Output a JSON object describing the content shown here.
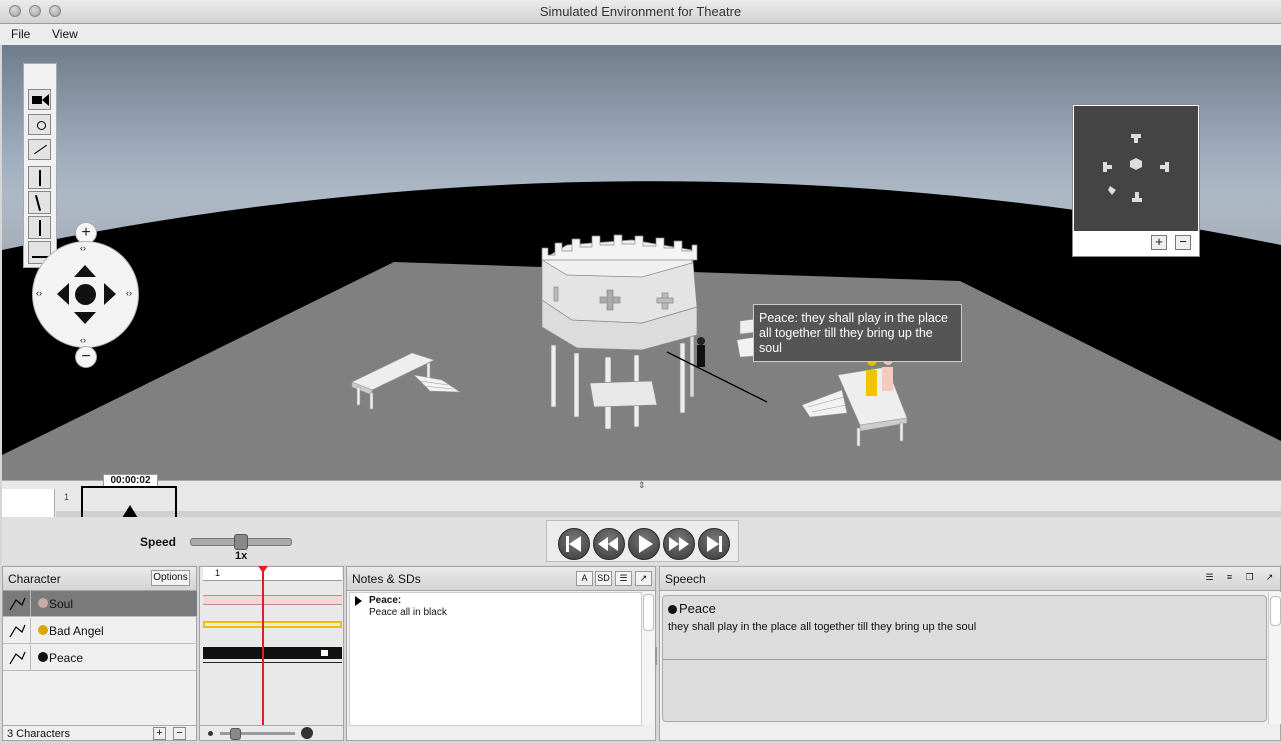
{
  "window": {
    "title": "Simulated Environment for Theatre"
  },
  "menu": {
    "file": "File",
    "view": "View"
  },
  "viewport": {
    "tooltip": {
      "speaker": "Peace",
      "text": "Peace: they shall play in the place all together till they bring up the soul"
    }
  },
  "minimap": {
    "zoom_in": "+",
    "zoom_out": "−"
  },
  "navigation": {
    "zoom_in": "+",
    "zoom_out": "−"
  },
  "timeline": {
    "time": "00:00:02",
    "marker": "1",
    "playhead_position": 0.04
  },
  "transport": {
    "speed_label": "Speed",
    "speed_value": "1x",
    "buttons": [
      "skip-back-icon",
      "rewind-icon",
      "play-icon",
      "fast-forward-icon",
      "skip-forward-icon"
    ]
  },
  "characters": {
    "title": "Character",
    "options_label": "Options",
    "count_label": "3 Characters",
    "add": "+",
    "remove": "−",
    "items": [
      {
        "name": "Soul",
        "color": "#c8a8a8",
        "selected": true
      },
      {
        "name": "Bad Angel",
        "color": "#d8a800",
        "selected": false
      },
      {
        "name": "Peace",
        "color": "#111111",
        "selected": false
      }
    ]
  },
  "track": {
    "marker": "1"
  },
  "notes": {
    "title": "Notes & SDs",
    "btn_a": "A",
    "btn_sd": "SD",
    "entries": [
      {
        "heading": "Peace:",
        "body": "Peace all in black"
      }
    ]
  },
  "speech": {
    "title": "Speech",
    "entries": [
      {
        "speaker": "Peace",
        "text": "they shall play in the place all together till they bring up the soul"
      }
    ]
  },
  "colors": {
    "playhead": "#e02020",
    "bad_angel": "#e8c000",
    "peace": "#111111"
  }
}
